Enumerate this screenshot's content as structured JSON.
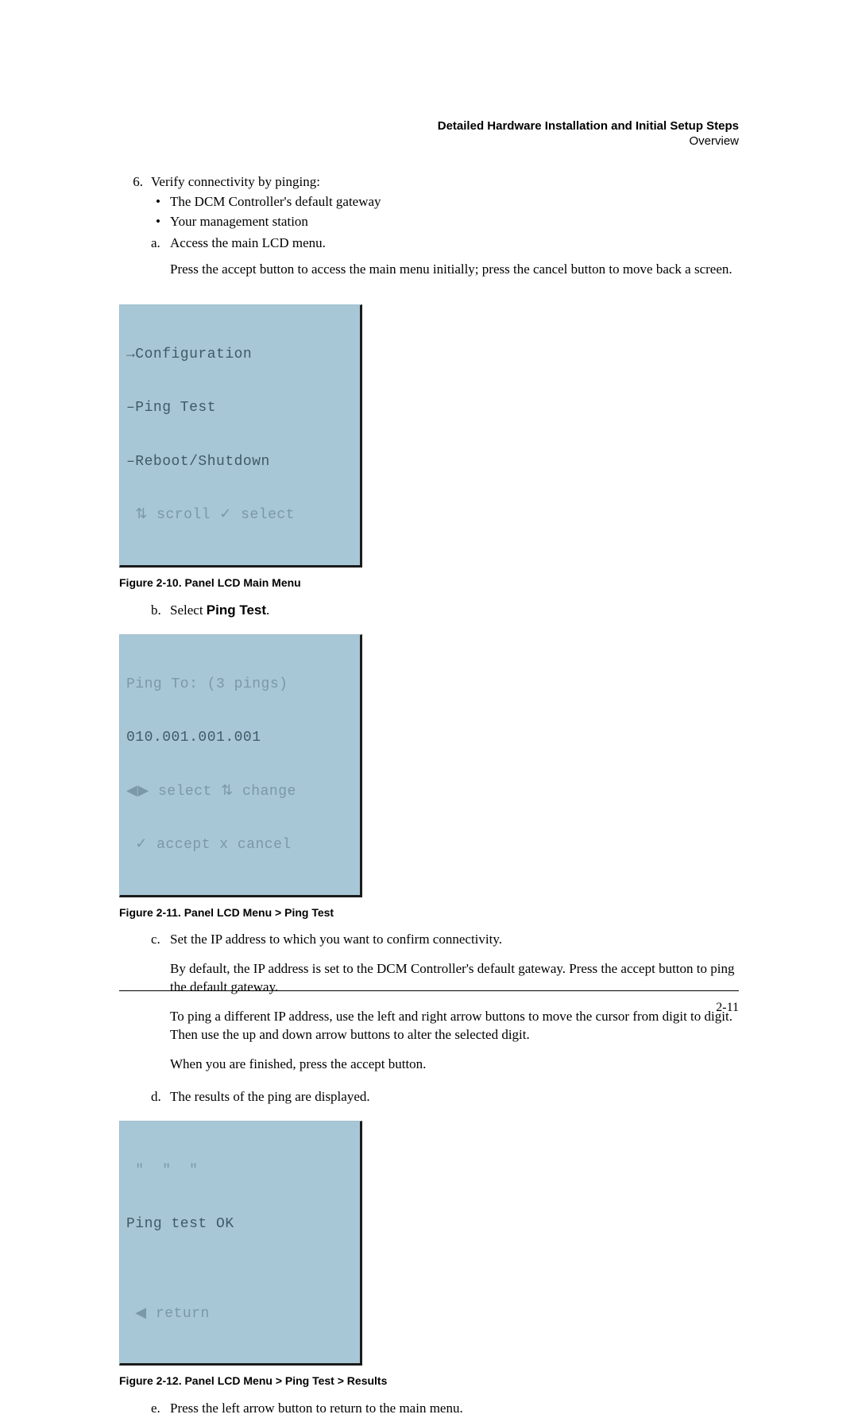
{
  "running_head": {
    "chapter": "Detailed Hardware Installation and Initial Setup Steps",
    "section": "Overview"
  },
  "step6": {
    "marker": "6.",
    "lead": "Verify connectivity by pinging:",
    "bullets": [
      "The DCM Controller's default gateway",
      "Your management station"
    ],
    "sub_a": {
      "marker": "a.",
      "text": "Access the main LCD menu.",
      "para": "Press the accept button to access the main menu initially; press the cancel button to move back a screen."
    },
    "fig10": {
      "lines": [
        "→Configuration",
        "–Ping Test",
        "–Reboot/Shutdown",
        " ⇅ scroll ✓ select"
      ],
      "caption": "Figure 2-10. Panel LCD Main Menu"
    },
    "sub_b": {
      "marker": "b.",
      "prefix": "Select ",
      "bold": "Ping Test",
      "suffix": "."
    },
    "fig11": {
      "lines": [
        "Ping To: (3 pings)",
        "010.001.001.001",
        "◀▶ select ⇅ change",
        " ✓ accept x cancel"
      ],
      "caption": "Figure 2-11. Panel LCD Menu > Ping Test"
    },
    "sub_c": {
      "marker": "c.",
      "text": "Set the IP address to which you want to confirm connectivity.",
      "p1": "By default, the IP address is set to the DCM Controller's default gateway. Press the accept button to ping the default gateway.",
      "p2": "To ping a different IP address, use the left and right arrow buttons to move the cursor from digit to digit. Then use the up and down arrow buttons to alter the selected digit.",
      "p3": "When you are finished, press the accept button."
    },
    "sub_d": {
      "marker": "d.",
      "text": "The results of the ping are displayed."
    },
    "fig12": {
      "lines": [
        " \"  \"  \"",
        "Ping test OK",
        "",
        " ◀ return"
      ],
      "caption": "Figure 2-12. Panel LCD Menu > Ping Test > Results"
    },
    "sub_e": {
      "marker": "e.",
      "text": "Press the left arrow button to return to the main menu."
    }
  },
  "page_number": "2-11"
}
